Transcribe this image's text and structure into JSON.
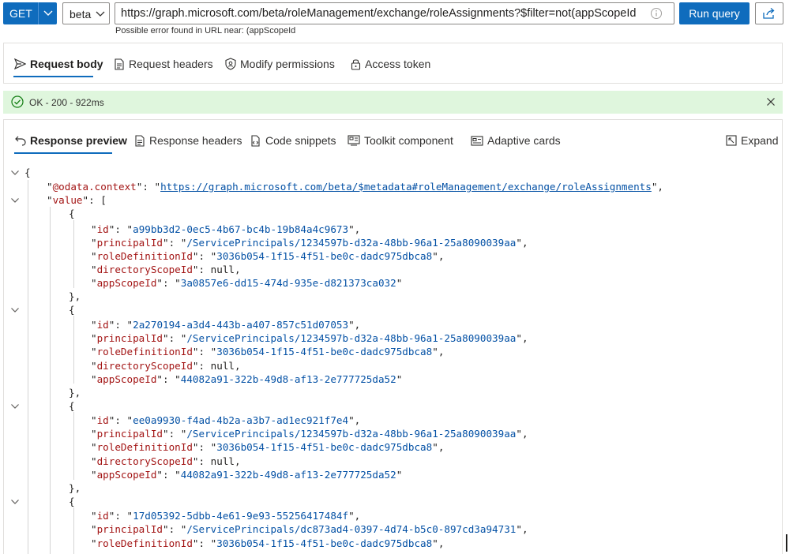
{
  "query": {
    "method": "GET",
    "version": "beta",
    "url": "https://graph.microsoft.com/beta/roleManagement/exchange/roleAssignments?$filter=not(appScopeId eq null)",
    "error": "Possible error found in URL near: (appScopeId",
    "run_label": "Run query"
  },
  "request_tabs": [
    {
      "label": "Request body",
      "icon": "send-icon",
      "active": true
    },
    {
      "label": "Request headers",
      "icon": "document-icon"
    },
    {
      "label": "Modify permissions",
      "icon": "shield-icon"
    },
    {
      "label": "Access token",
      "icon": "lock-icon"
    }
  ],
  "status": {
    "text": "OK - 200 - 922ms",
    "color": "#dff6dd"
  },
  "response_tabs": [
    {
      "label": "Response preview",
      "icon": "undo-arrow-icon",
      "active": true
    },
    {
      "label": "Response headers",
      "icon": "document-icon"
    },
    {
      "label": "Code snippets",
      "icon": "code-file-icon"
    },
    {
      "label": "Toolkit component",
      "icon": "component-icon"
    },
    {
      "label": "Adaptive cards",
      "icon": "card-icon"
    }
  ],
  "expand_label": "Expand",
  "json": {
    "context_key": "@odata.context",
    "context_url": "https://graph.microsoft.com/beta/$metadata#roleManagement/exchange/roleAssignments",
    "value_key": "value",
    "items": [
      {
        "id": "a99bb3d2-0ec5-4b67-bc4b-19b84a4c9673",
        "principalId": "/ServicePrincipals/1234597b-d32a-48bb-96a1-25a8090039aa",
        "roleDefinitionId": "3036b054-1f15-4f51-be0c-dadc975dbca8",
        "directoryScopeId": "null",
        "appScopeId": "3a0857e6-dd15-474d-935e-d821373ca032"
      },
      {
        "id": "2a270194-a3d4-443b-a407-857c51d07053",
        "principalId": "/ServicePrincipals/1234597b-d32a-48bb-96a1-25a8090039aa",
        "roleDefinitionId": "3036b054-1f15-4f51-be0c-dadc975dbca8",
        "directoryScopeId": "null",
        "appScopeId": "44082a91-322b-49d8-af13-2e777725da52"
      },
      {
        "id": "ee0a9930-f4ad-4b2a-a3b7-ad1ec921f7e4",
        "principalId": "/ServicePrincipals/1234597b-d32a-48bb-96a1-25a8090039aa",
        "roleDefinitionId": "3036b054-1f15-4f51-be0c-dadc975dbca8",
        "directoryScopeId": "null",
        "appScopeId": "44082a91-322b-49d8-af13-2e777725da52"
      },
      {
        "id": "17d05392-5dbb-4e61-9e93-55256417484f",
        "principalId": "/ServicePrincipals/dc873ad4-0397-4d74-b5c0-897cd3a94731",
        "roleDefinitionId": "3036b054-1f15-4f51-be0c-dadc975dbca8"
      }
    ]
  },
  "colors": {
    "accent": "#0f6cbd",
    "key": "#a31515",
    "string": "#0451a5",
    "success": "#107c10"
  }
}
